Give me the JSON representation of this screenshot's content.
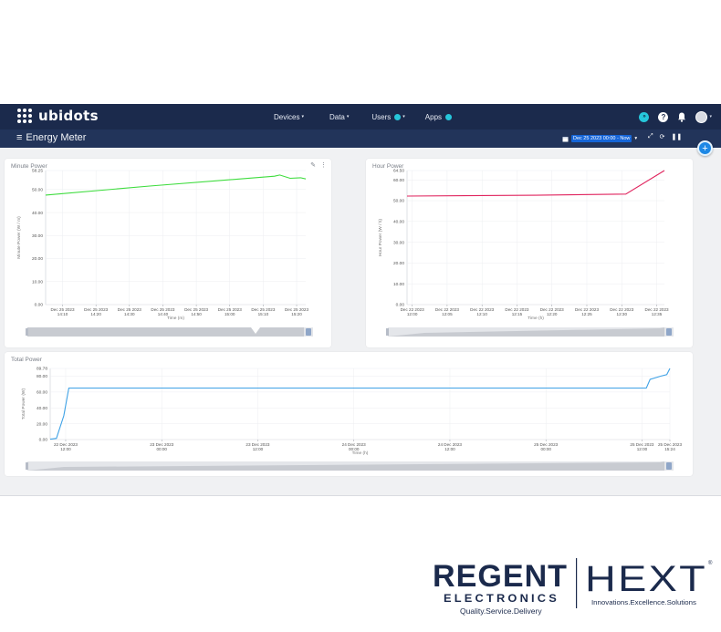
{
  "app": {
    "logo_text": "ubidots",
    "nav": [
      {
        "label": "Devices",
        "badge": false
      },
      {
        "label": "Data",
        "badge": false
      },
      {
        "label": "Users",
        "badge": true
      },
      {
        "label": "Apps",
        "badge": true
      }
    ],
    "dashboard_title": "Energy Meter",
    "date_range": "Dec 25 2023 00:00 - Now",
    "colors": {
      "topbar": "#1b2a4c",
      "subbar": "#22345a",
      "accent": "#26c6da",
      "range": "#1565d8"
    }
  },
  "widgets": {
    "minute": {
      "title": "Minute Power"
    },
    "hour": {
      "title": "Hour Power"
    },
    "total": {
      "title": "Total Power"
    }
  },
  "chart_data": [
    {
      "type": "line",
      "title": "Minute Power",
      "xlabel": "Time (m)",
      "ylabel": "Minute Power (W / m)",
      "ylim": [
        0,
        58.25
      ],
      "yticks": [
        "0.00",
        "10.00",
        "20.00",
        "30.00",
        "40.00",
        "50.00",
        "58.25"
      ],
      "xticks": [
        [
          "Dec 25 2023",
          "14:10"
        ],
        [
          "Dec 25 2023",
          "14:20"
        ],
        [
          "Dec 25 2023",
          "14:30"
        ],
        [
          "Dec 25 2023",
          "14:40"
        ],
        [
          "Dec 25 2023",
          "14:50"
        ],
        [
          "Dec 25 2023",
          "15:00"
        ],
        [
          "Dec 25 2023",
          "15:10"
        ],
        [
          "Dec 25 2023",
          "15:20"
        ]
      ],
      "color": "#3ddc3d",
      "series": [
        {
          "points": [
            [
              0,
              47.6
            ],
            [
              0.4,
              51.5
            ],
            [
              0.88,
              55.8
            ],
            [
              0.9,
              56.3
            ],
            [
              0.94,
              54.9
            ],
            [
              0.98,
              55.1
            ],
            [
              1.0,
              54.6
            ]
          ]
        }
      ]
    },
    {
      "type": "line",
      "title": "Hour Power",
      "xlabel": "Time (h)",
      "ylabel": "Hour Power (W / h)",
      "ylim": [
        0,
        64.5
      ],
      "yticks": [
        "0.00",
        "10.00",
        "20.00",
        "30.00",
        "40.00",
        "50.00",
        "60.00",
        "64.50"
      ],
      "xticks": [
        [
          "Dec 22 2023",
          "12:00"
        ],
        [
          "Dec 22 2023",
          "12:05"
        ],
        [
          "Dec 22 2023",
          "12:10"
        ],
        [
          "Dec 22 2023",
          "12:15"
        ],
        [
          "Dec 22 2023",
          "12:20"
        ],
        [
          "Dec 22 2023",
          "12:25"
        ],
        [
          "Dec 22 2023",
          "12:30"
        ],
        [
          "Dec 22 2023",
          "12:35"
        ]
      ],
      "color": "#e0245e",
      "series": [
        {
          "points": [
            [
              0,
              52.2
            ],
            [
              0.5,
              52.6
            ],
            [
              0.85,
              53.2
            ],
            [
              1.0,
              64.5
            ]
          ]
        }
      ]
    },
    {
      "type": "line",
      "title": "Total Power",
      "xlabel": "Time (h)",
      "ylabel": "Total Power (W)",
      "ylim": [
        0,
        89.78
      ],
      "yticks": [
        "0.00",
        "20.00",
        "40.00",
        "60.00",
        "80.00",
        "89.78"
      ],
      "xticks": [
        [
          "22 Dec 2023",
          "12:00"
        ],
        [
          "23 Dec 2023",
          "00:00"
        ],
        [
          "23 Dec 2023",
          "12:00"
        ],
        [
          "24 Dec 2023",
          "00:00"
        ],
        [
          "24 Dec 2023",
          "12:00"
        ],
        [
          "25 Dec 2023",
          "00:00"
        ],
        [
          "25 Dec 2023",
          "12:00"
        ],
        [
          "25 Dec 2023",
          "15:24"
        ]
      ],
      "color": "#3fa2e6",
      "series": [
        {
          "points": [
            [
              0,
              0.5
            ],
            [
              0.01,
              1.5
            ],
            [
              0.022,
              30
            ],
            [
              0.03,
              65
            ],
            [
              0.5,
              65
            ],
            [
              0.962,
              65
            ],
            [
              0.968,
              76
            ],
            [
              0.985,
              80
            ],
            [
              0.995,
              82
            ],
            [
              1.0,
              89.78
            ]
          ]
        }
      ]
    }
  ],
  "branding": {
    "regent": "REGENT",
    "electronics": "ELECTRONICS",
    "regent_tagline": "Quality.Service.Delivery",
    "hext": "HEXT",
    "hext_tagline": "Innovations.Excellence.Solutions",
    "colors": {
      "navy": "#1b2a4c"
    }
  }
}
